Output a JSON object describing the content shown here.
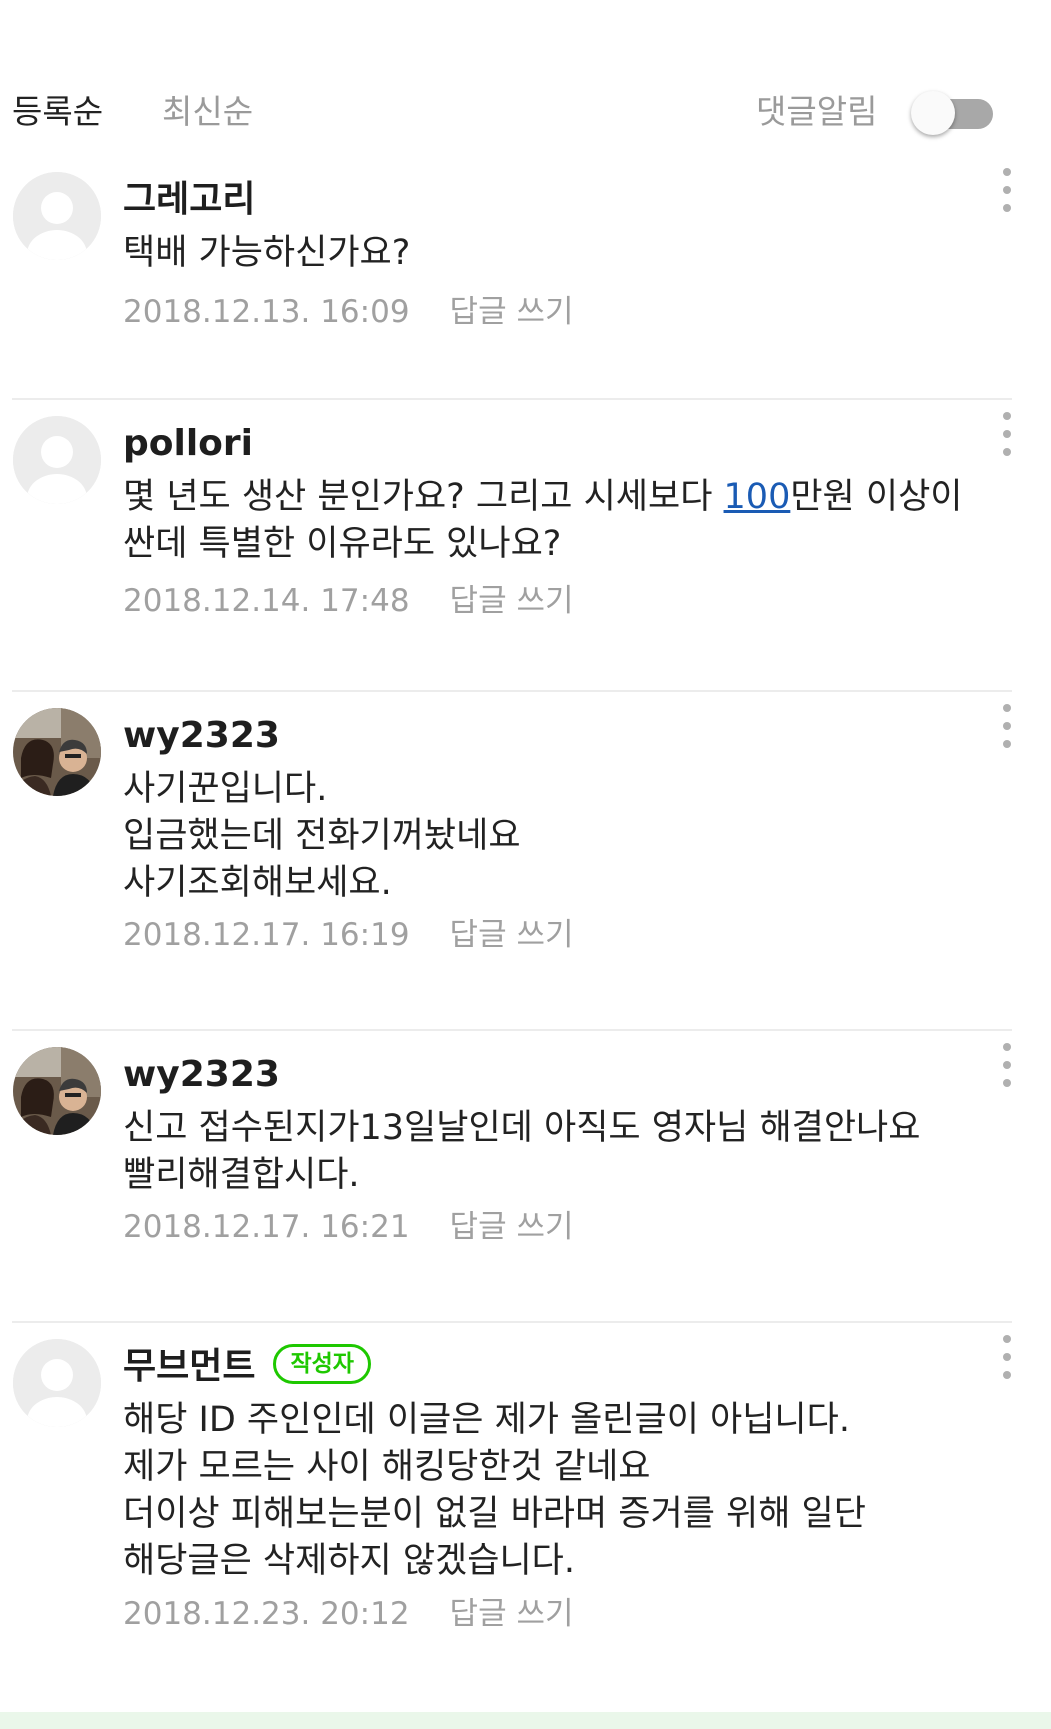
{
  "sort": {
    "registered": "등록순",
    "newest": "최신순"
  },
  "notify": {
    "label": "댓글알림",
    "enabled": false
  },
  "reply_label": "답글 쓰기",
  "badge_label": "작성자",
  "comments": [
    {
      "author": "그레고리",
      "avatar": "default",
      "lines": [
        "택배 가능하신가요?"
      ],
      "date": "2018.12.13. 16:09"
    },
    {
      "author": "pollori",
      "avatar": "default",
      "line1_pre": "몇 년도 생산 분인가요? 그리고 시세보다 ",
      "line1_link": "100",
      "line1_post": "만원 이상이",
      "line2": "싼데 특별한 이유라도 있나요?",
      "date": "2018.12.14. 17:48"
    },
    {
      "author": "wy2323",
      "avatar": "photo",
      "lines": [
        "사기꾼입니다.",
        "입금했는데 전화기꺼놨네요",
        "사기조회해보세요."
      ],
      "date": "2018.12.17. 16:19"
    },
    {
      "author": "wy2323",
      "avatar": "photo",
      "lines": [
        "신고 접수된지가13일날인데 아직도 영자님 해결안나요",
        "빨리해결합시다."
      ],
      "date": "2018.12.17. 16:21"
    },
    {
      "author": "무브먼트",
      "avatar": "default",
      "is_writer": true,
      "lines": [
        "해당 ID 주인인데 이글은 제가 올린글이 아닙니다.",
        "제가 모르는 사이 해킹당한것 같네요",
        "더이상 피해보는분이 없길 바라며 증거를 위해 일단",
        "해당글은 삭제하지 않겠습니다."
      ],
      "date": "2018.12.23. 20:12"
    }
  ]
}
